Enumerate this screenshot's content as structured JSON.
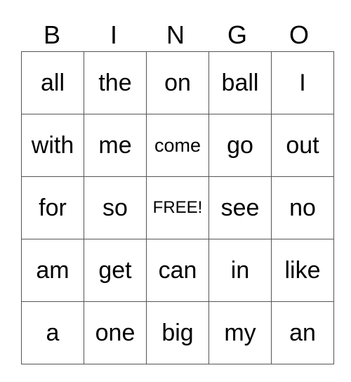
{
  "header": [
    "B",
    "I",
    "N",
    "G",
    "O"
  ],
  "rows": [
    [
      "all",
      "the",
      "on",
      "ball",
      "I"
    ],
    [
      "with",
      "me",
      "come",
      "go",
      "out"
    ],
    [
      "for",
      "so",
      "FREE!",
      "see",
      "no"
    ],
    [
      "am",
      "get",
      "can",
      "in",
      "like"
    ],
    [
      "a",
      "one",
      "big",
      "my",
      "an"
    ]
  ]
}
